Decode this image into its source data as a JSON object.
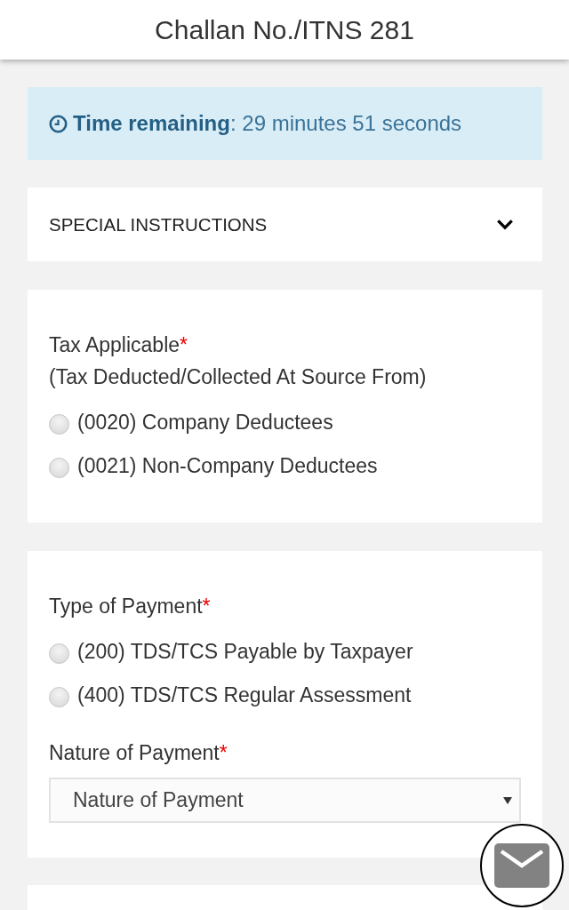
{
  "header": {
    "title": "Challan No./ITNS 281"
  },
  "timer": {
    "text": "**Time remaining**: 29 minutes 51 seconds"
  },
  "special_instructions": {
    "title": "SPECIAL INSTRUCTIONS",
    "expanded": false
  },
  "sections": [
    {
      "label": "Tax Applicable",
      "required_mark": "*",
      "sublabel": "(Tax Deducted/Collected At Source From)",
      "options": [
        {
          "label": "(0020) Company Deductees",
          "selected": false
        },
        {
          "label": "(0021) Non-Company Deductees",
          "selected": false
        }
      ]
    },
    {
      "label": "Type of Payment",
      "required_mark": "*",
      "options": [
        {
          "label": "(200) TDS/TCS Payable by Taxpayer",
          "selected": false
        },
        {
          "label": "(400) TDS/TCS Regular Assessment",
          "selected": false
        }
      ],
      "select": {
        "label": "Nature of Payment",
        "required_mark": "*",
        "placeholder": "Nature of Payment"
      }
    }
  ]
}
